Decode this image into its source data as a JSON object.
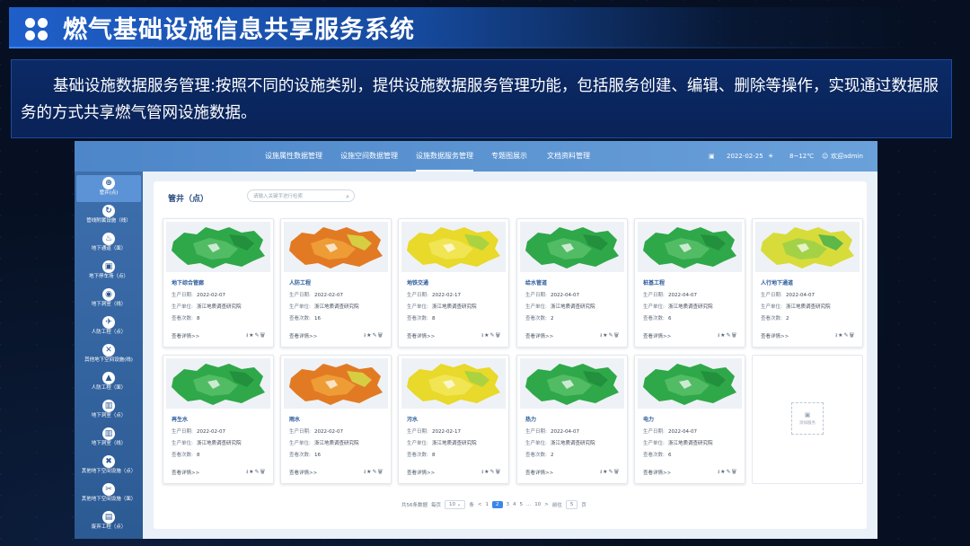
{
  "slide": {
    "title": "燃气基础设施信息共享服务系统",
    "description": "基础设施数据服务管理:按照不同的设施类别，提供设施数据服务管理功能，包括服务创建、编辑、删除等操作，实现通过数据服务的方式共享燃气管网设施数据。"
  },
  "app": {
    "nav": [
      "设施属性数据管理",
      "设施空间数据管理",
      "设施数据服务管理",
      "专题图展示",
      "文档资料管理"
    ],
    "active_nav": 2,
    "date": "2022-02-25",
    "temperature": "8~12℃",
    "user": "欢迎admin"
  },
  "sidebar": [
    {
      "label": "管井(点)",
      "icon": "grid-icon",
      "glyph": "⊕",
      "active": true
    },
    {
      "label": "管线附属设施（线）",
      "icon": "pipe-icon",
      "glyph": "↻"
    },
    {
      "label": "地下通道（面）",
      "icon": "bulb-icon",
      "glyph": "♨"
    },
    {
      "label": "地下停车场（点）",
      "icon": "parking-icon",
      "glyph": "▣"
    },
    {
      "label": "地下洞室（线）",
      "icon": "cave-icon",
      "glyph": "◉"
    },
    {
      "label": "人防工程（点）",
      "icon": "runner-icon",
      "glyph": "✈"
    },
    {
      "label": "其他地下空间设施(线)",
      "icon": "tools-icon",
      "glyph": "✕"
    },
    {
      "label": "人防工程（面）",
      "icon": "warning-icon",
      "glyph": "▲"
    },
    {
      "label": "地下洞室（点）",
      "icon": "building-icon",
      "glyph": "▥"
    },
    {
      "label": "地下洞室（线）",
      "icon": "building-icon",
      "glyph": "▥"
    },
    {
      "label": "其他地下空间设施（点）",
      "icon": "close-circle-icon",
      "glyph": "✖"
    },
    {
      "label": "其他地下空间设施（面）",
      "icon": "wrench-icon",
      "glyph": "✂"
    },
    {
      "label": "废弃工程（点）",
      "icon": "trash-icon",
      "glyph": "▤"
    }
  ],
  "content": {
    "title": "管井（点）",
    "search_placeholder": "请输入关键字进行检索",
    "field_labels": {
      "date": "生产日期:",
      "unit": "生产单位:",
      "views": "查看次数:"
    },
    "more_label": "查看详情>>",
    "add_label": "添加服务",
    "cards": [
      {
        "name": "地下综合管廊",
        "date": "2022-02-07",
        "unit": "浙江地质调查研究院",
        "views": "8",
        "map": "green"
      },
      {
        "name": "人防工程",
        "date": "2022-02-07",
        "unit": "浙江地质调查研究院",
        "views": "16",
        "map": "orange"
      },
      {
        "name": "地铁交通",
        "date": "2022-02-17",
        "unit": "浙江地质调查研究院",
        "views": "8",
        "map": "yellow"
      },
      {
        "name": "给水管道",
        "date": "2022-04-07",
        "unit": "浙江地质调查研究院",
        "views": "2",
        "map": "green"
      },
      {
        "name": "桩基工程",
        "date": "2022-04-07",
        "unit": "浙江地质调查研究院",
        "views": "6",
        "map": "green"
      },
      {
        "name": "人行地下通道",
        "date": "2022-04-07",
        "unit": "浙江地质调查研究院",
        "views": "2",
        "map": "yellow-green"
      },
      {
        "name": "再生水",
        "date": "2022-02-07",
        "unit": "浙江地质调查研究院",
        "views": "8",
        "map": "green"
      },
      {
        "name": "雨水",
        "date": "2022-02-07",
        "unit": "浙江地质调查研究院",
        "views": "16",
        "map": "orange"
      },
      {
        "name": "污水",
        "date": "2022-02-17",
        "unit": "浙江地质调查研究院",
        "views": "8",
        "map": "yellow"
      },
      {
        "name": "热力",
        "date": "2022-04-07",
        "unit": "浙江地质调查研究院",
        "views": "2",
        "map": "green"
      },
      {
        "name": "电力",
        "date": "2022-04-07",
        "unit": "浙江地质调查研究院",
        "views": "6",
        "map": "green"
      }
    ]
  },
  "pager": {
    "total": "共56条数据",
    "per_page_label": "每页",
    "per_page": "10",
    "unit": "条",
    "pages": [
      "1",
      "2",
      "3",
      "4",
      "5",
      "...",
      "10"
    ],
    "current_page": "2",
    "goto_label": "前往",
    "goto_value": "5",
    "goto_unit": "页",
    "prev": "<",
    "next": ">"
  },
  "colors": {
    "map_green": "#2fa84a",
    "map_orange": "#e27a24",
    "map_yellow": "#e8d92a",
    "accent": "#3b86e8"
  }
}
